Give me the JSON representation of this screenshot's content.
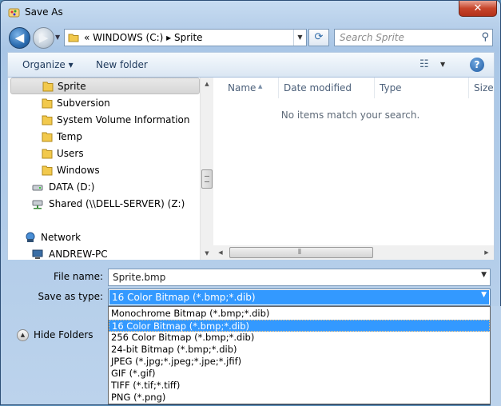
{
  "window": {
    "title": "Save As",
    "close_glyph": "✕"
  },
  "nav": {
    "back_glyph": "◀",
    "forward_glyph": "▶"
  },
  "address": {
    "text": "« WINDOWS (C:) ▸ Sprite"
  },
  "search": {
    "placeholder": "Search Sprite"
  },
  "toolbar": {
    "organize": "Organize ▾",
    "new_folder": "New folder",
    "help": "?"
  },
  "sidebar": {
    "items": [
      {
        "label": "Sprite",
        "icon": "folder-icon"
      },
      {
        "label": "Subversion",
        "icon": "folder-icon"
      },
      {
        "label": "System Volume Information",
        "icon": "folder-icon"
      },
      {
        "label": "Temp",
        "icon": "folder-icon"
      },
      {
        "label": "Users",
        "icon": "folder-icon"
      },
      {
        "label": "Windows",
        "icon": "folder-icon"
      },
      {
        "label": "DATA (D:)",
        "icon": "drive-icon"
      },
      {
        "label": "Shared (\\\\DELL-SERVER) (Z:)",
        "icon": "network-drive-icon"
      },
      {
        "label": "Network",
        "icon": "network-icon"
      },
      {
        "label": "ANDREW-PC",
        "icon": "computer-icon"
      }
    ]
  },
  "columns": [
    "Name",
    "Date modified",
    "Type",
    "Size"
  ],
  "list": {
    "empty_message": "No items match your search."
  },
  "form": {
    "file_name_label": "File name:",
    "file_name_value": "Sprite.bmp",
    "save_type_label": "Save as type:",
    "save_type_value": "16 Color Bitmap (*.bmp;*.dib)"
  },
  "type_options": [
    "Monochrome Bitmap (*.bmp;*.dib)",
    "16 Color Bitmap (*.bmp;*.dib)",
    "256 Color Bitmap (*.bmp;*.dib)",
    "24-bit Bitmap (*.bmp;*.dib)",
    "JPEG (*.jpg;*.jpeg;*.jpe;*.jfif)",
    "GIF (*.gif)",
    "TIFF (*.tif;*.tiff)",
    "PNG (*.png)"
  ],
  "selected_type_index": 1,
  "hide_folders_label": "Hide Folders",
  "colors": {
    "selection": "#3399ff",
    "frame": "#a9c6e6"
  }
}
